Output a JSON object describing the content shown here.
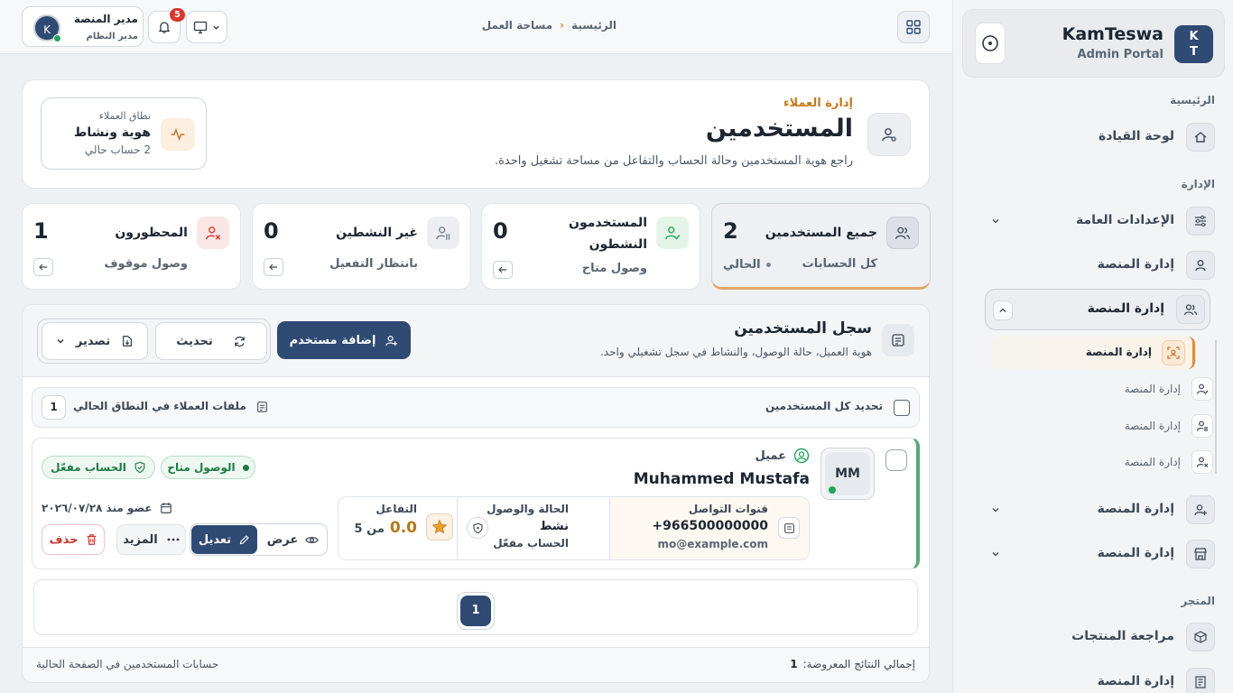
{
  "sidebar": {
    "brand_initials_1": "K",
    "brand_initials_2": "T",
    "brand_name": "KamTeswa",
    "brand_sub": "Admin Portal",
    "sections": {
      "home": "الرئيسية",
      "admin": "الإدارة",
      "store": "المتجر"
    },
    "items": {
      "dashboard": "لوحة القيادة",
      "general_settings": "الإعدادات العامة",
      "platform_mgmt_1": "إدارة المنصة",
      "platform_mgmt_open": "إدارة المنصة",
      "sub_active": "إدارة المنصة",
      "sub_2": "إدارة المنصة",
      "sub_3": "إدارة المنصة",
      "sub_4": "إدارة المنصة",
      "platform_mgmt_2": "إدارة المنصة",
      "platform_mgmt_3": "إدارة المنصة",
      "product_reviews": "مراجعة المنتجات",
      "platform_mgmt_4": "إدارة المنصة"
    }
  },
  "topbar": {
    "breadcrumb_home": "الرئيسية",
    "breadcrumb_current": "مساحة العمل",
    "user_name": "مدير المنصة",
    "user_role": "مدير النظام",
    "user_initial": "K",
    "notif_count": "5"
  },
  "header": {
    "eyebrow": "إدارة العملاء",
    "title": "المستخدمين",
    "subtitle": "راجع هوية المستخدمين وحالة الحساب والتفاعل من مساحة تشغيل واحدة.",
    "scope_label": "نطاق العملاء",
    "scope_title": "هوية ونشاط",
    "scope_count": "2 حساب حالي"
  },
  "stats": [
    {
      "title": "جميع المستخدمين",
      "value": "2",
      "sub": "كل الحسابات",
      "note": "الحالي"
    },
    {
      "title": "المستخدمون النشطون",
      "value": "0",
      "sub": "وصول متاح"
    },
    {
      "title": "غير النشطين",
      "value": "0",
      "sub": "بانتظار التفعيل"
    },
    {
      "title": "المحظورون",
      "value": "1",
      "sub": "وصول موقوف"
    }
  ],
  "registry": {
    "title": "سجل المستخدمين",
    "subtitle": "هوية العميل، حالة الوصول، والنشاط في سجل تشغيلي واحد.",
    "add_label": "إضافة مستخدم",
    "refresh_label": "تحديث",
    "export_label": "تصدير",
    "select_all": "تحديد كل المستخدمين",
    "profiles_label": "ملفات العملاء في النطاق الحالي",
    "profiles_count": "1"
  },
  "user": {
    "initials": "MM",
    "type": "عميل",
    "name": "Muhammed Mustafa",
    "badge_access": "الوصول متاح",
    "badge_account": "الحساب مفعّل",
    "contact_label": "قنوات التواصل",
    "phone": "+966500000000",
    "email": "mo@example.com",
    "status_label": "الحالة والوصول",
    "status_value": "نشط",
    "status_sub": "الحساب مفعّل",
    "engage_label": "التفاعل",
    "engage_value": "0.0",
    "engage_of": "من 5",
    "member_since": "عضو منذ ٢٠٢٦/٠٧/٢٨",
    "view_label": "عرض",
    "edit_label": "تعديل",
    "more_label": "المزيد",
    "delete_label": "حذف"
  },
  "pagination": {
    "current": "1"
  },
  "footer": {
    "total_label": "إجمالي النتائج المعروضة:",
    "total_value": "1",
    "right_note": "حسابات المستخدمين في الصفحة الحالية"
  },
  "colors": {
    "accent": "#e08a3a",
    "primary": "#2f4a73",
    "success": "#1f7a46",
    "danger": "#d9534f"
  }
}
